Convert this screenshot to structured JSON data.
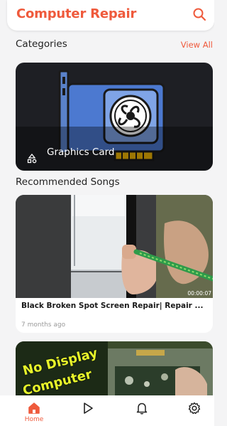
{
  "header": {
    "title": "Computer Repair",
    "search_icon": "search-icon"
  },
  "categories": {
    "label": "Categories",
    "view_all": "View All",
    "items": [
      {
        "label": "Graphics Card",
        "icon": "shapes-icon"
      }
    ]
  },
  "recommended": {
    "label": "Recommended Songs",
    "videos": [
      {
        "title": "Black Broken Spot Screen Repair| Repair ...",
        "time_ago": "7 months ago",
        "duration": "00:00:07"
      },
      {
        "thumb_text_line1": "No Display",
        "thumb_text_line2": "Computer"
      }
    ]
  },
  "bottom_nav": {
    "items": [
      {
        "label": "Home",
        "icon": "home-icon",
        "active": true
      },
      {
        "icon": "play-icon"
      },
      {
        "icon": "bell-icon"
      },
      {
        "icon": "settings-icon"
      }
    ]
  },
  "colors": {
    "accent": "#ef5a3c",
    "background": "#f4f4f5",
    "card_dark": "#1e1f24"
  }
}
